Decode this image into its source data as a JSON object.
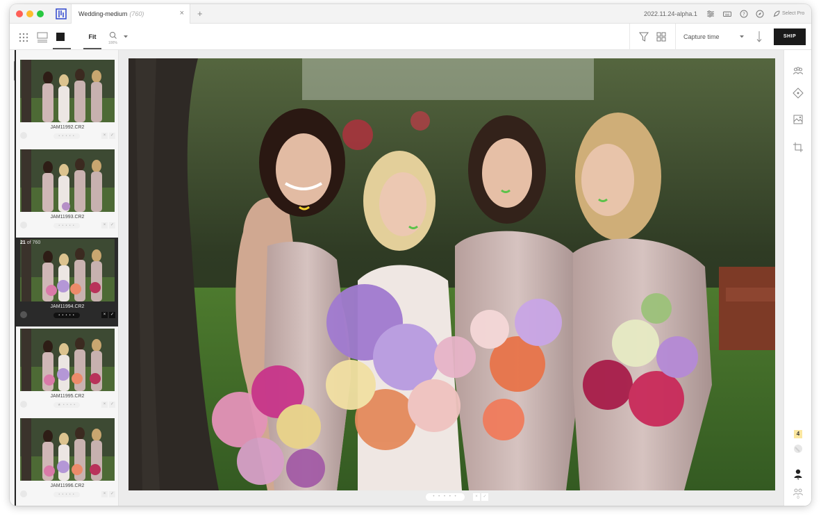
{
  "titlebar": {
    "tab_name": "Wedding-medium",
    "tab_count": "(760)",
    "close_glyph": "×",
    "new_tab_glyph": "+",
    "version": "2022.11.24-alpha.1",
    "select_pro": "Select Pro"
  },
  "toolbar": {
    "fit_label": "Fit",
    "zoom_pct": "100%",
    "sort_label": "Capture time",
    "ship_label": "SHIP"
  },
  "filmstrip": {
    "position_current": "21",
    "position_total": "of 760",
    "items": [
      {
        "name": "JAM11992.CR2",
        "stars": "• • • • •"
      },
      {
        "name": "JAM11993.CR2",
        "stars": "• • • • •"
      },
      {
        "name": "JAM11994.CR2",
        "stars": "• • • • •"
      },
      {
        "name": "JAM11995.CR2",
        "stars": "★ • • • •"
      },
      {
        "name": "JAM11996.CR2",
        "stars": "• • • • •"
      }
    ]
  },
  "viewer": {
    "bottom_stars": "• • • • •",
    "reject_glyph": "×",
    "pick_glyph": "✓"
  },
  "right_panel": {
    "faces_badge": "4",
    "people_count": "4",
    "groups_count": "0"
  },
  "colors": {
    "accent_dark": "#1a1a1a",
    "badge_yellow": "#fbe7a0",
    "face_marker_green": "#5cc24a",
    "face_marker_yellow": "#f2d12f"
  }
}
